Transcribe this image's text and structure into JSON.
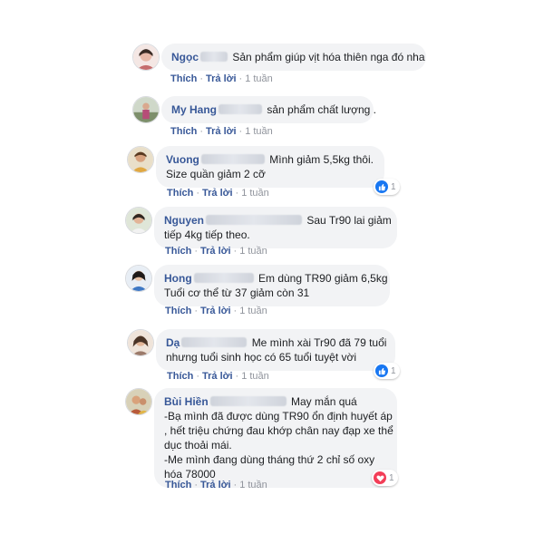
{
  "accent_color": "#385898",
  "comments": [
    {
      "name": "Ngọc",
      "text_lines": [
        "Sản phẩm giúp vịt hóa thiên nga đó nha"
      ],
      "like_label": "Thích",
      "reply_label": "Trả lời",
      "time": "1 tuần",
      "reaction": null
    },
    {
      "name": "My Hang",
      "text_lines": [
        "sản phẩm chất lượng ."
      ],
      "like_label": "Thích",
      "reply_label": "Trả lời",
      "time": "1 tuần",
      "reaction": null
    },
    {
      "name": "Vuong",
      "text_lines": [
        "Mình giảm 5,5kg thôi.",
        "Size quần giảm 2 cỡ"
      ],
      "like_label": "Thích",
      "reply_label": "Trả lời",
      "time": "1 tuần",
      "reaction": {
        "icon": "like-icon",
        "count": "1"
      }
    },
    {
      "name": "Nguyen",
      "text_lines": [
        "Sau Tr90 lai giảm",
        "tiếp 4kg tiếp theo."
      ],
      "like_label": "Thích",
      "reply_label": "Trả lời",
      "time": "1 tuần",
      "reaction": null
    },
    {
      "name": "Hong",
      "text_lines": [
        "Em dùng TR90 giảm 6,5kg",
        "Tuổi cơ thể từ 37 giảm còn 31"
      ],
      "like_label": "Thích",
      "reply_label": "Trả lời",
      "time": "1 tuần",
      "reaction": null
    },
    {
      "name": "Dạ",
      "text_lines": [
        "Me mình xài Tr90 đã 79 tuổi",
        "nhưng tuổi sinh học có 65 tuổi tuyệt vời"
      ],
      "like_label": "Thích",
      "reply_label": "Trả lời",
      "time": "1 tuần",
      "reaction": {
        "icon": "like-icon",
        "count": "1"
      }
    },
    {
      "name": "Bùi Hiền",
      "text_lines": [
        "May mắn quá",
        "-Bạ mình đã được dùng TR90 ổn định huyết áp",
        ", hết triệu chứng đau khớp chân nay đạp xe thể",
        "dục thoải mái.",
        "-Me mình đang dùng tháng thứ 2 chỉ số oxy",
        "hóa 78000"
      ],
      "like_label": "Thích",
      "reply_label": "Trả lời",
      "time": "1 tuần",
      "reaction": {
        "icon": "love-icon",
        "count": "1"
      }
    }
  ]
}
